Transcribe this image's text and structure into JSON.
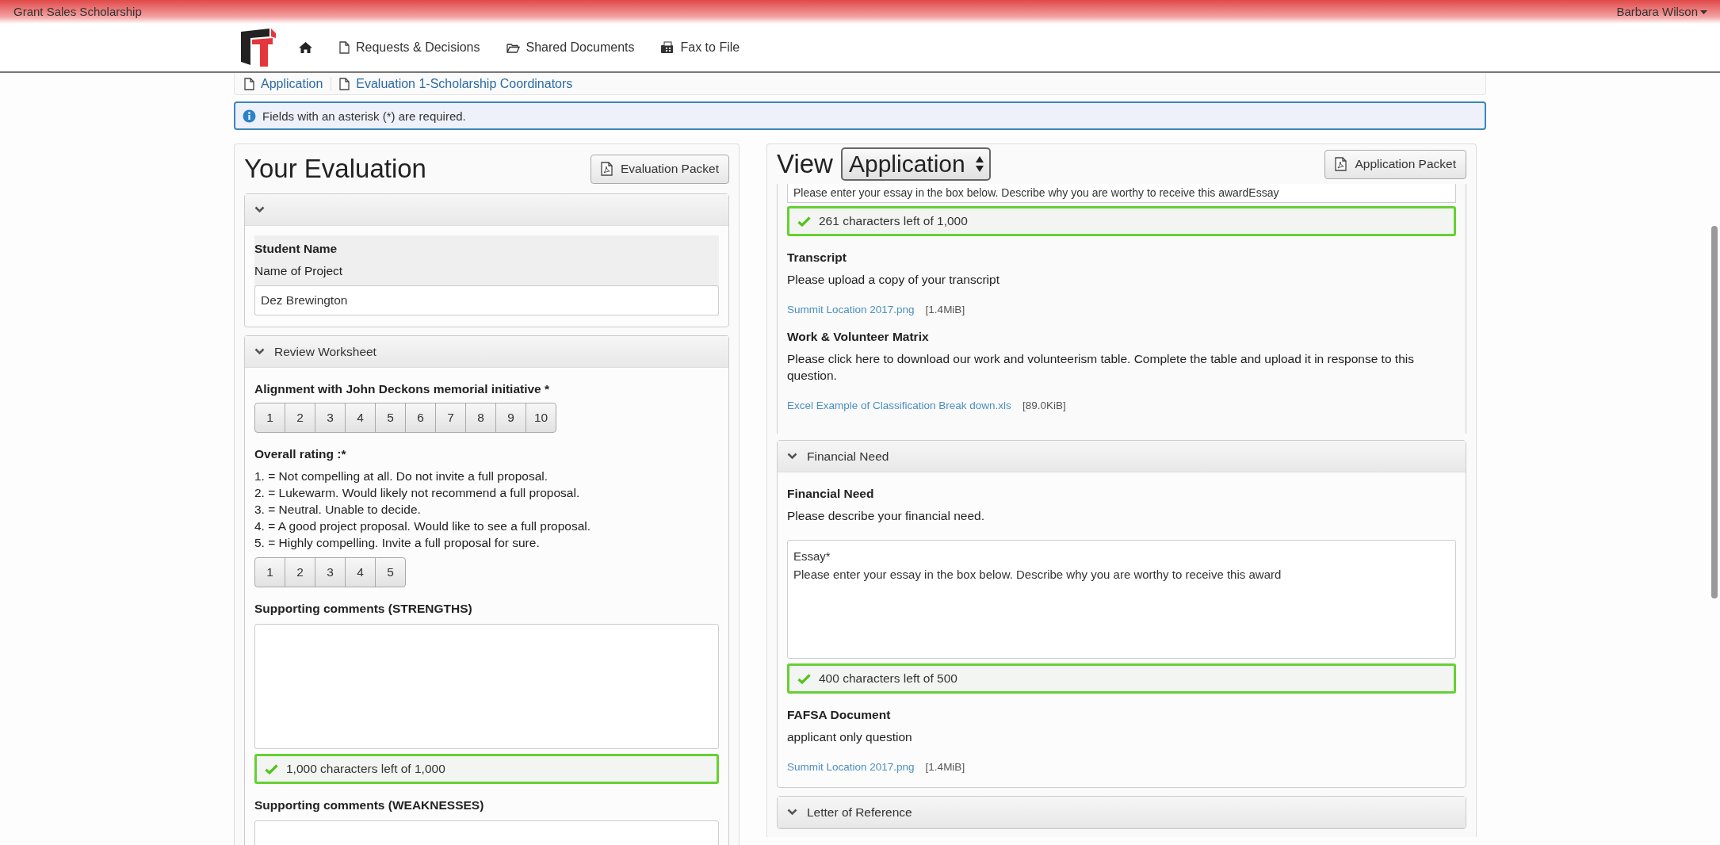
{
  "app_bar": {
    "title": "Grant Sales Scholarship",
    "user": "Barbara Wilson"
  },
  "nav": {
    "items": [
      {
        "kind": "home"
      },
      {
        "kind": "document",
        "label": "Requests & Decisions"
      },
      {
        "kind": "folder",
        "label": "Shared Documents"
      },
      {
        "kind": "fax",
        "label": "Fax to File"
      }
    ]
  },
  "breadcrumb": [
    "Application",
    "Evaluation 1-Scholarship Coordinators"
  ],
  "alert": "Fields with an asterisk (*) are required.",
  "evaluation": {
    "title": "Your Evaluation",
    "packet_button": "Evaluation Packet",
    "summary": {
      "expanded": true,
      "heading": "Student Name",
      "label": "Name of Project",
      "value": "Dez Brewington"
    },
    "worksheet": {
      "header": "Review Worksheet",
      "expanded": true,
      "questions": [
        {
          "kind": "scale",
          "label": "Alignment with John Deckons memorial initiative *",
          "options": [
            "1",
            "2",
            "3",
            "4",
            "5",
            "6",
            "7",
            "8",
            "9",
            "10"
          ]
        },
        {
          "kind": "scale",
          "label": "Overall rating :*",
          "description": [
            "1. = Not compelling at all. Do not invite a full proposal.",
            "2. = Lukewarm. Would likely not recommend a full proposal.",
            "3. = Neutral. Unable to decide.",
            "4. = A good project proposal. Would like to see a full proposal.",
            "5. = Highly compelling. Invite a full proposal for sure."
          ],
          "options": [
            "1",
            "2",
            "3",
            "4",
            "5"
          ]
        },
        {
          "kind": "comment",
          "label": "Supporting comments (STRENGTHS)",
          "counter": "1,000 characters left of 1,000"
        },
        {
          "kind": "comment",
          "label": "Supporting comments (WEAKNESSES)"
        }
      ]
    }
  },
  "application_view": {
    "label": "View",
    "select": "Application",
    "packet_button": "Application Packet",
    "clipped_essay": "Please enter your essay in the box below. Describe why you are worthy to receive this awardEssay",
    "clipped_counter": "261 characters left of 1,000",
    "items": [
      {
        "kind": "file",
        "title": "Transcript",
        "text": "Please upload a copy of your transcript",
        "file": "Summit Location 2017.png",
        "size": "[1.4MiB]"
      },
      {
        "kind": "file",
        "title": "Work & Volunteer Matrix",
        "text": "Please click here to download our work and volunteerism table. Complete the table and upload it in response to this question.",
        "file": "Excel Example of Classification Break down.xls",
        "size": "[89.0KiB]"
      }
    ],
    "sections": [
      {
        "header": "Financial Need",
        "expanded": true,
        "items": [
          {
            "kind": "essay",
            "title": "Financial Need",
            "text": "Please describe your financial need.",
            "essay_label": "Essay*",
            "essay_text": "Please enter your essay in the box below. Describe why you are worthy to receive this award",
            "counter": "400 characters left of 500"
          },
          {
            "kind": "file",
            "title": "FAFSA Document",
            "text": "applicant only question",
            "file": "Summit Location 2017.png",
            "size": "[1.4MiB]"
          }
        ]
      },
      {
        "header": "Letter of Reference",
        "expanded": true
      }
    ]
  }
}
